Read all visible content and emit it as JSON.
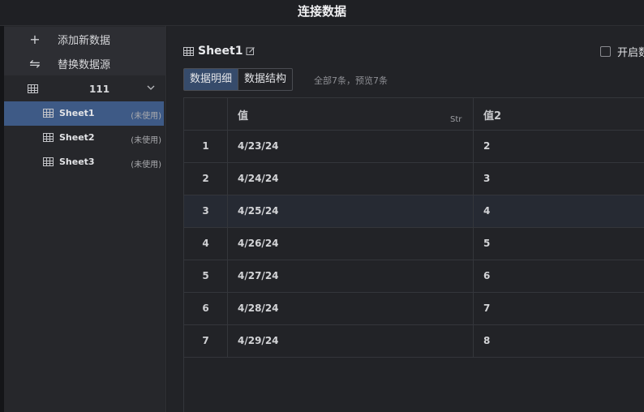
{
  "window": {
    "title": "连接数据"
  },
  "sidebar": {
    "actions": [
      {
        "icon": "plus-icon",
        "label": "添加新数据"
      },
      {
        "icon": "swap-arrows-icon",
        "label": "替换数据源"
      }
    ],
    "group": {
      "name": "111",
      "expanded": true
    },
    "sheets": [
      {
        "name": "Sheet1",
        "tag": "(未使用)",
        "selected": true
      },
      {
        "name": "Sheet2",
        "tag": "(未使用)",
        "selected": false
      },
      {
        "name": "Sheet3",
        "tag": "(未使用)",
        "selected": false
      }
    ]
  },
  "main": {
    "sheet_title": "Sheet1",
    "enable_label": "开启数",
    "tabs": [
      {
        "label": "数据明细",
        "active": true
      },
      {
        "label": "数据结构",
        "active": false
      }
    ],
    "count_info": "全部7条，预览7条",
    "table": {
      "columns": [
        {
          "label": "值",
          "type_tag": "Str"
        },
        {
          "label": "值2",
          "type_tag": ""
        }
      ],
      "rows": [
        {
          "index": "1",
          "v1": "4/23/24",
          "v2": "2"
        },
        {
          "index": "2",
          "v1": "4/24/24",
          "v2": "3"
        },
        {
          "index": "3",
          "v1": "4/25/24",
          "v2": "4"
        },
        {
          "index": "4",
          "v1": "4/26/24",
          "v2": "5"
        },
        {
          "index": "5",
          "v1": "4/27/24",
          "v2": "6"
        },
        {
          "index": "6",
          "v1": "4/28/24",
          "v2": "7"
        },
        {
          "index": "7",
          "v1": "4/29/24",
          "v2": "8"
        }
      ]
    }
  },
  "colors": {
    "accent_selected": "#3e5a86",
    "tab_active": "#364b6b",
    "background": "#1e1f22"
  }
}
